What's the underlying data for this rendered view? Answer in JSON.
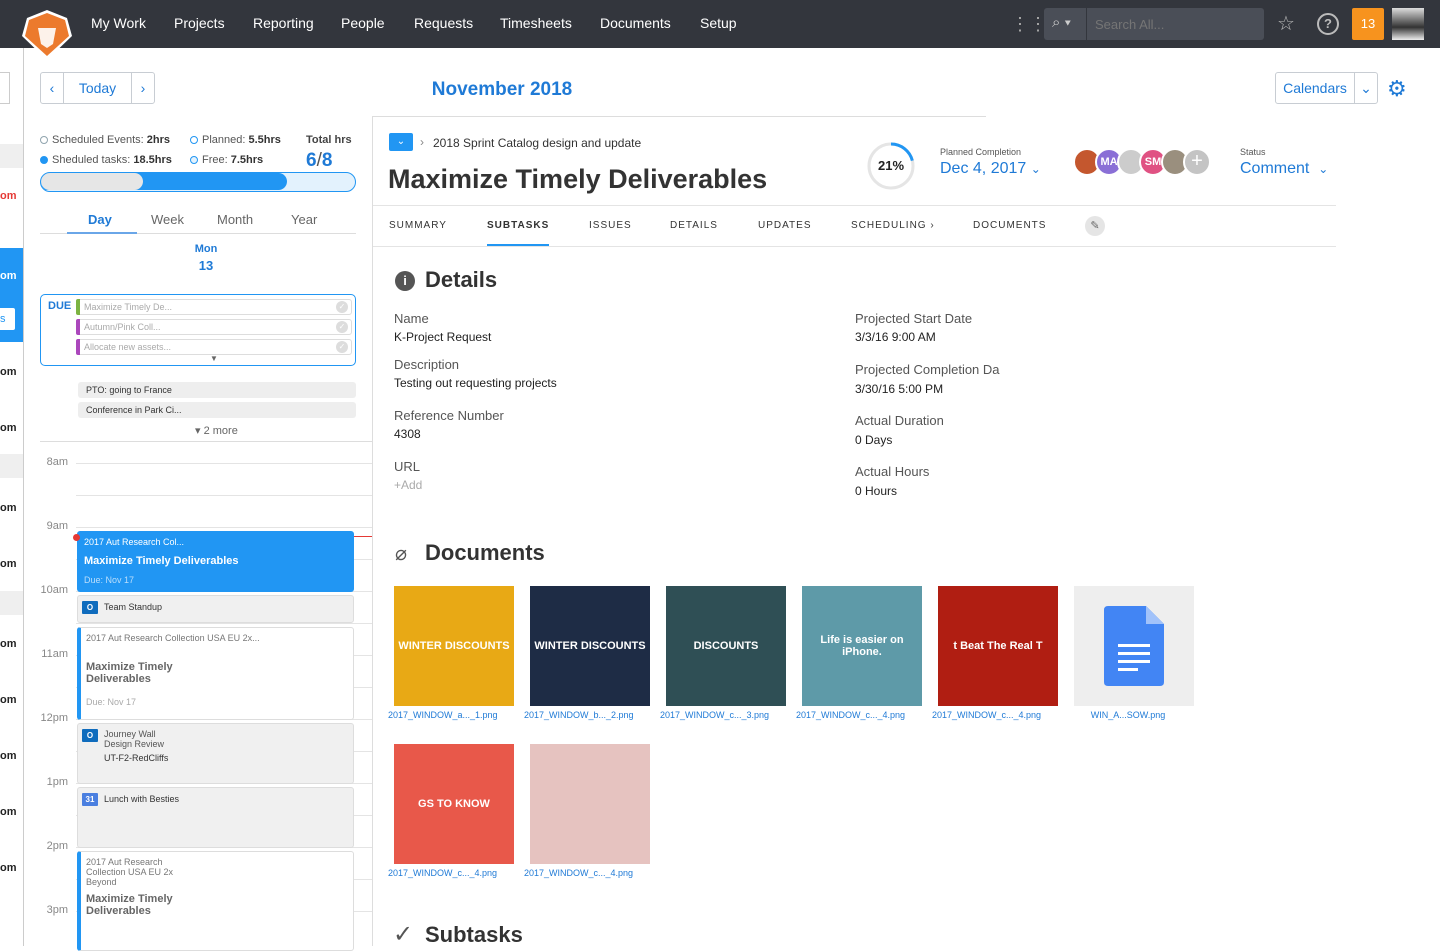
{
  "nav": {
    "items": [
      "My Work",
      "Projects",
      "Reporting",
      "People",
      "Requests",
      "Timesheets",
      "Documents",
      "Setup"
    ],
    "search_placeholder": "Search All...",
    "notifications": "13"
  },
  "left_strip": {
    "fragments": [
      "om",
      "om",
      "s",
      "om",
      "om",
      "om",
      "om",
      "om",
      "om",
      "om",
      "om",
      "om"
    ]
  },
  "calendar": {
    "today_label": "Today",
    "month_title": "November 2018",
    "stats": {
      "scheduled_events_label": "Scheduled Events:",
      "scheduled_events": "2hrs",
      "planned_label": "Planned:",
      "planned": "5.5hrs",
      "total_label": "Total hrs",
      "scheduled_tasks_label": "Sheduled tasks:",
      "scheduled_tasks": "18.5hrs",
      "free_label": "Free:",
      "free": "7.5hrs",
      "total_used": "6",
      "total_sep": "/",
      "total_cap": "8"
    },
    "views": [
      "Day",
      "Week",
      "Month",
      "Year"
    ],
    "active_view": "Day",
    "day_name": "Mon",
    "day_number": "13",
    "due_label": "DUE",
    "due_items": [
      {
        "label": "Maximize Timely De...",
        "color": "#7cb342"
      },
      {
        "label": "Autumn/Pink Coll...",
        "color": "#ab47bc"
      },
      {
        "label": "Allocate new assets...",
        "color": "#ab47bc"
      }
    ],
    "all_day": [
      "PTO: going to France",
      "Conference in Park Ci..."
    ],
    "more": "2 more",
    "hours": [
      "8am",
      "9am",
      "10am",
      "11am",
      "12pm",
      "1pm",
      "2pm",
      "3pm"
    ],
    "events": [
      {
        "project": "2017 Aut Research Col...",
        "title": "Maximize Timely Deliverables",
        "due": "Due: Nov 17"
      },
      {
        "title": "Team Standup"
      },
      {
        "project": "2017 Aut Research Collection USA EU 2x...",
        "title": "Maximize Timely Deliverables",
        "due": "Due: Nov 17"
      },
      {
        "title": "Journey Wall Design Review",
        "location": "UT-F2-RedCliffs"
      },
      {
        "title": "Lunch with Besties",
        "calendar_day": "31"
      },
      {
        "project": "2017 Aut Research Collection USA EU 2x Beyond",
        "title": "Maximize Timely Deliverables"
      }
    ]
  },
  "toolbar": {
    "calendars_label": "Calendars"
  },
  "detail": {
    "breadcrumb": "2018 Sprint Catalog design and update",
    "title": "Maximize Timely Deliverables",
    "progress": "21%",
    "progress_value": 21,
    "planned_completion_label": "Planned Completion",
    "planned_completion": "Dec 4, 2017",
    "avatars": [
      "MA",
      "SM"
    ],
    "status_label": "Status",
    "status": "Comment",
    "tabs": [
      "SUMMARY",
      "SUBTASKS",
      "ISSUES",
      "DETAILS",
      "UPDATES",
      "SCHEDULING ›",
      "DOCUMENTS"
    ],
    "active_tab": "SUBTASKS",
    "details_heading": "Details",
    "fields_left": [
      {
        "label": "Name",
        "value": "K-Project Request"
      },
      {
        "label": "Description",
        "value": "Testing out requesting projects"
      },
      {
        "label": "Reference Number",
        "value": "4308"
      },
      {
        "label": "URL",
        "value": "+Add"
      }
    ],
    "fields_right": [
      {
        "label": "Projected Start Date",
        "value": "3/3/16 9:00 AM"
      },
      {
        "label": "Projected Completion Da",
        "value": "3/30/16 5:00 PM"
      },
      {
        "label": "Actual Duration",
        "value": "0 Days"
      },
      {
        "label": "Actual Hours",
        "value": "0 Hours"
      }
    ],
    "documents_heading": "Documents",
    "documents": [
      {
        "name": "2017_WINDOW_a..._1.png",
        "art": "WINTER DISCOUNTS",
        "bg": "#e8a915"
      },
      {
        "name": "2017_WINDOW_b..._2.png",
        "art": "WINTER DISCOUNTS",
        "bg": "#1e2c45"
      },
      {
        "name": "2017_WINDOW_c..._3.png",
        "art": "DISCOUNTS",
        "bg": "#2f4f55"
      },
      {
        "name": "2017_WINDOW_c..._4.png",
        "art": "Life is easier on iPhone.",
        "bg": "#5e9aa8"
      },
      {
        "name": "2017_WINDOW_c..._4.png",
        "art": "t Beat The Real T",
        "bg": "#b01e12"
      },
      {
        "name": "WIN_A...SOW.png",
        "art": "",
        "bg": "#eeeeee"
      },
      {
        "name": "2017_WINDOW_c..._4.png",
        "art": "GS TO KNOW",
        "bg": "#e8584a"
      },
      {
        "name": "2017_WINDOW_c..._4.png",
        "art": "",
        "bg": "#e6c3c0"
      }
    ],
    "subtasks_heading": "Subtasks"
  }
}
